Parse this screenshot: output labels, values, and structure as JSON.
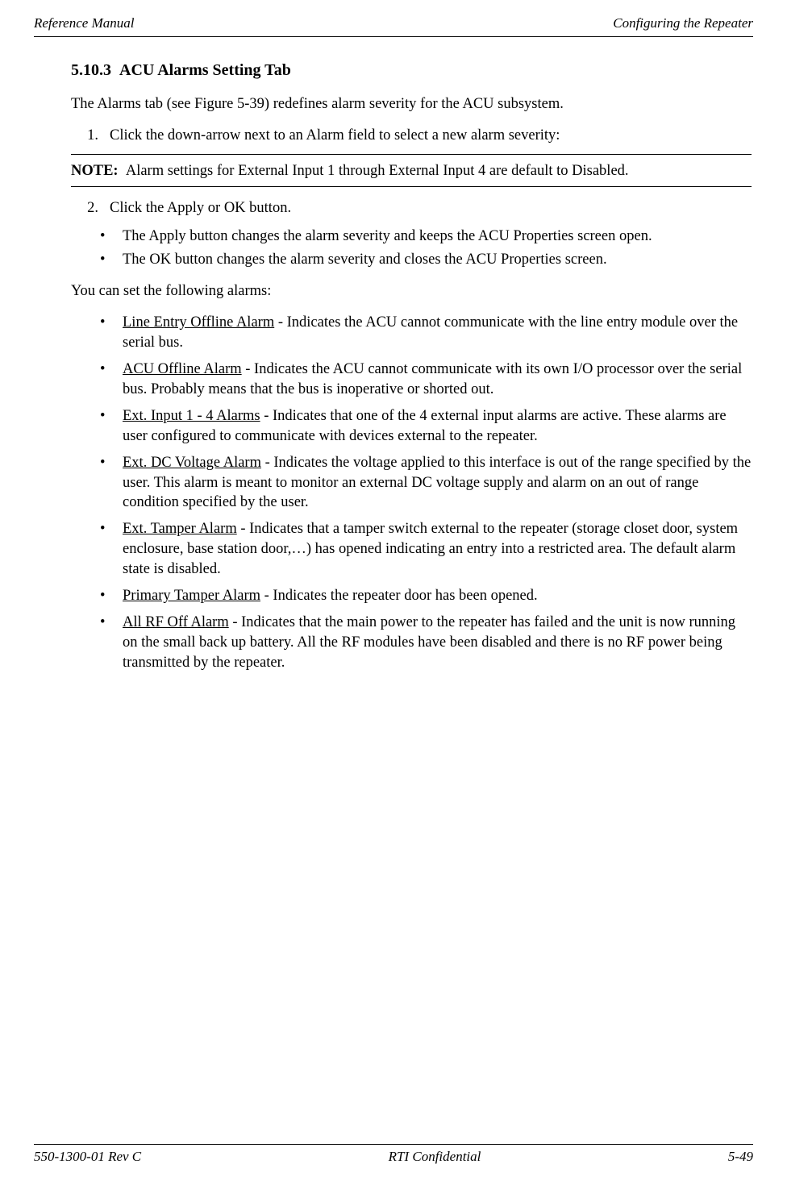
{
  "header": {
    "left": "Reference Manual",
    "right": "Configuring the Repeater"
  },
  "section": {
    "number": "5.10.3",
    "title": "ACU Alarms Setting Tab",
    "intro": "The Alarms tab (see Figure 5-39) redefines alarm severity for the ACU subsystem.",
    "step1_num": "1.",
    "step1": "Click the down-arrow next to an Alarm field to select a new alarm severity:",
    "note_label": "NOTE:",
    "note_body": "Alarm settings for External Input 1 through External Input 4 are default to Disabled.",
    "step2_num": "2.",
    "step2": "Click the Apply or OK button.",
    "step2_sub1": "The Apply button changes the alarm severity and keeps the ACU Properties screen open.",
    "step2_sub2": "The OK button changes the alarm severity and closes the ACU Properties screen.",
    "alarms_intro": "You can set the following alarms:"
  },
  "alarms": {
    "a1_name": "Line Entry Offline Alarm",
    "a1_desc": " - Indicates the ACU cannot communicate with the line entry module over the serial bus.",
    "a2_name": "ACU Offline Alarm",
    "a2_desc": " - Indicates the ACU cannot communicate with its own I/O processor over the serial bus. Probably means that the bus is inoperative or shorted out.",
    "a3_name": "Ext. Input 1 - 4 Alarms",
    "a3_desc": " - Indicates that one of the 4 external input alarms are active. These alarms are user configured to communicate with devices external to the repeater.",
    "a4_name": "Ext. DC Voltage Alarm",
    "a4_desc": " - Indicates the voltage applied to this interface is out of the range specified by the user. This alarm is meant to monitor an external DC voltage supply and alarm on an out of range condition specified by the user.",
    "a5_name": "Ext. Tamper Alarm",
    "a5_desc": " - Indicates that a tamper switch external to the repeater (storage closet door, system enclosure, base station door,…) has opened indicating an entry into a restricted area. The default alarm state is disabled.",
    "a6_name": "Primary Tamper Alarm",
    "a6_desc": " - Indicates the repeater door has been opened.",
    "a7_name": "All RF Off Alarm",
    "a7_desc": " - Indicates that the main power to the repeater has failed and the unit is now running on the small back up battery. All the RF modules have been disabled and there is no RF power being transmitted by the repeater."
  },
  "footer": {
    "left": "550-1300-01 Rev C",
    "center": "RTI Confidential",
    "right": "5-49"
  }
}
